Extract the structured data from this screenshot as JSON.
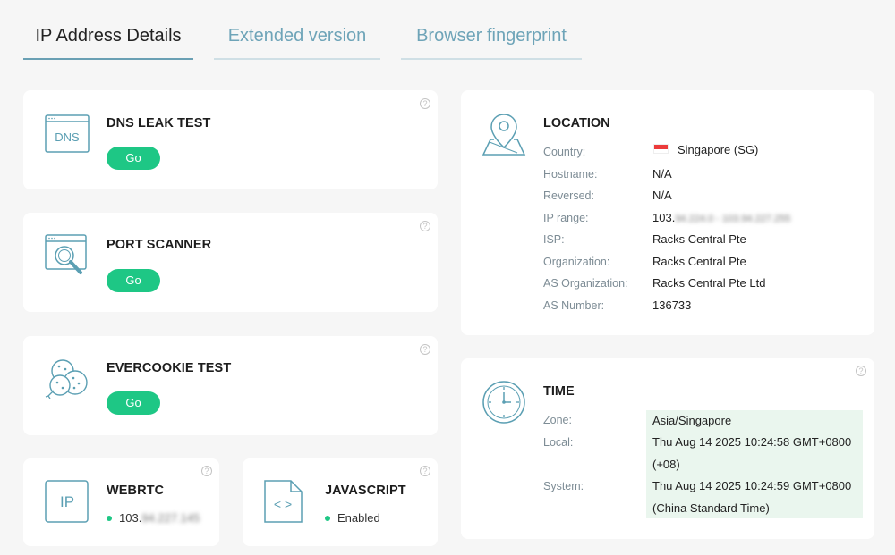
{
  "tabs": [
    {
      "label": "IP Address Details",
      "active": true
    },
    {
      "label": "Extended version",
      "active": false
    },
    {
      "label": "Browser fingerprint",
      "active": false
    }
  ],
  "tools": {
    "dns": {
      "title": "DNS LEAK TEST",
      "button": "Go",
      "icon_text": "DNS"
    },
    "port": {
      "title": "PORT SCANNER",
      "button": "Go"
    },
    "evercookie": {
      "title": "EVERCOOKIE TEST",
      "button": "Go"
    },
    "webrtc": {
      "title": "WEBRTC",
      "icon_text": "IP",
      "ip_prefix": "103.",
      "ip_masked": "94.227.145"
    },
    "javascript": {
      "title": "JAVASCRIPT",
      "status": "Enabled",
      "icon_text": "< >"
    }
  },
  "help_symbol": "?",
  "location": {
    "title": "LOCATION",
    "rows": [
      {
        "label": "Country:",
        "value": "Singapore (SG)"
      },
      {
        "label": "Hostname:",
        "value": "N/A"
      },
      {
        "label": "Reversed:",
        "value": "N/A"
      },
      {
        "label": "IP range:",
        "value": "103.",
        "masked": "94.224.0 - 103.94.227.255"
      },
      {
        "label": "ISP:",
        "value": "Racks Central Pte"
      },
      {
        "label": "Organization:",
        "value": "Racks Central Pte"
      },
      {
        "label": "AS Organization:",
        "value": "Racks Central Pte Ltd"
      },
      {
        "label": "AS Number:",
        "value": "136733"
      }
    ]
  },
  "time": {
    "title": "TIME",
    "zone_label": "Zone:",
    "zone_value": "Asia/Singapore",
    "local_label": "Local:",
    "local_value_1": "Thu Aug 14 2025 10:24:58 GMT+0800",
    "local_value_2": "(+08)",
    "system_label": "System:",
    "system_value_1": "Thu Aug 14 2025 10:24:59 GMT+0800",
    "system_value_2": "(China Standard Time)"
  },
  "colors": {
    "accent_teal": "#6aa0b4",
    "go_green": "#1ec785",
    "highlight_green": "#eaf6ee"
  }
}
